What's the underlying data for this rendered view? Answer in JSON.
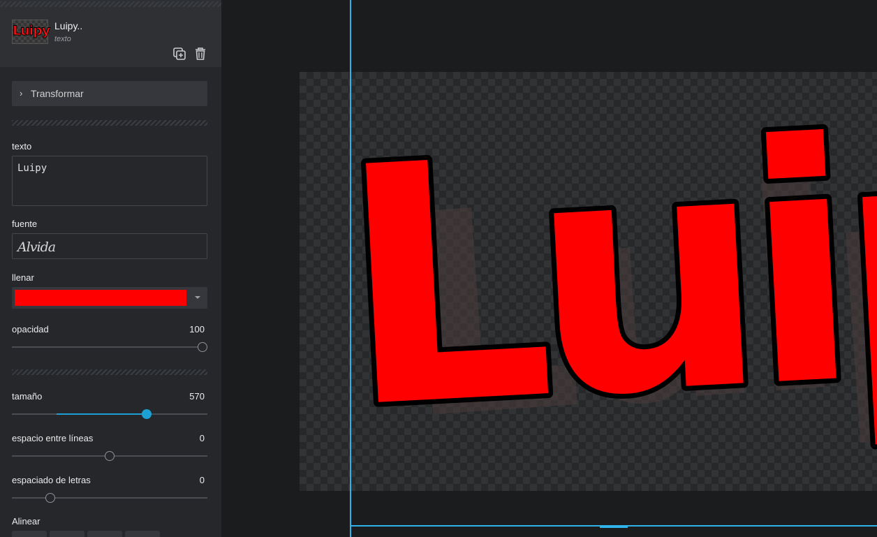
{
  "layer": {
    "name": "Luipy..",
    "type": "texto",
    "thumbnail_text": "Luipy"
  },
  "transform": {
    "label": "Transformar"
  },
  "text_field": {
    "label": "texto",
    "value": "Luipy"
  },
  "font": {
    "label": "fuente",
    "value": "Alvida"
  },
  "fill": {
    "label": "llenar",
    "color": "#ff0000"
  },
  "opacity": {
    "label": "opacidad",
    "value": "100",
    "fraction": 1.0
  },
  "size": {
    "label": "tamaño",
    "value": "570",
    "fraction": 0.7
  },
  "line_spacing": {
    "label": "espacio entre líneas",
    "value": "0",
    "fraction": 0.5
  },
  "letter_spacing": {
    "label": "espaciado de letras",
    "value": "0",
    "fraction": 0.18
  },
  "align": {
    "label": "Alinear",
    "active_index": 1
  },
  "canvas": {
    "text": "Luipy",
    "fill_color": "#ff0000",
    "stroke_color": "#000000",
    "shadow_color": "#4a3c3c",
    "accent": "#2fb3e8"
  },
  "icons": {
    "duplicate": "duplicate-icon",
    "delete": "trash-icon",
    "expand": "chevron-right-icon"
  }
}
